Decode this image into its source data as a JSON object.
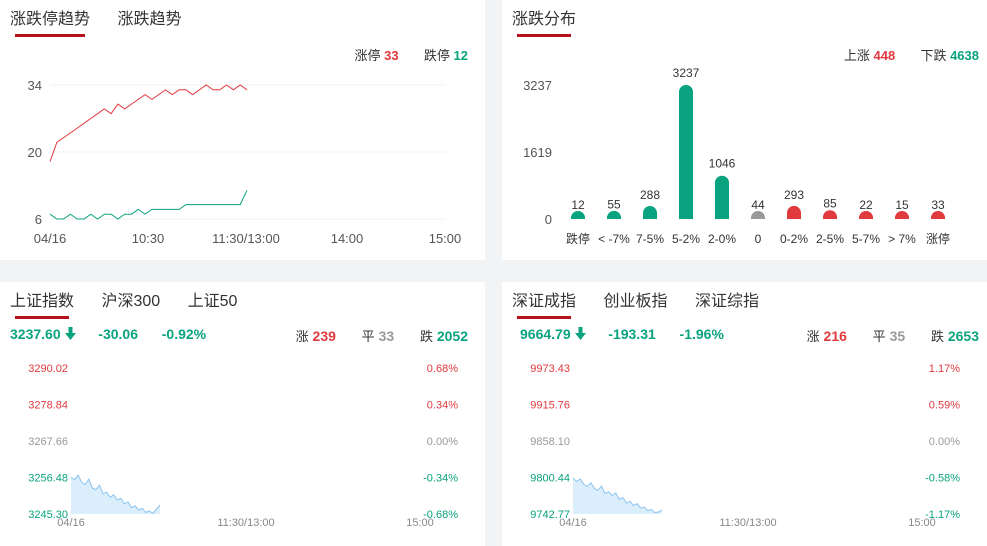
{
  "limit_trend": {
    "tabs": [
      "涨跌停趋势",
      "涨跌趋势"
    ],
    "summary": {
      "up_label": "涨停",
      "up_value": "33",
      "down_label": "跌停",
      "down_value": "12"
    },
    "chart_data": {
      "type": "line",
      "x_ticks": [
        "04/16",
        "10:30",
        "11:30/13:00",
        "14:00",
        "15:00"
      ],
      "y_ticks": [
        "34",
        "20",
        "6"
      ],
      "ylim": [
        6,
        34
      ],
      "series": [
        {
          "name": "涨停",
          "color": "#e0393e",
          "values": [
            18,
            22,
            23,
            24,
            25,
            26,
            27,
            28,
            29,
            28,
            30,
            29,
            30,
            31,
            32,
            31,
            32,
            33,
            32,
            33,
            33,
            32,
            33,
            34,
            33,
            33,
            34,
            33,
            34,
            33
          ]
        },
        {
          "name": "跌停",
          "color": "#0aa37f",
          "values": [
            7,
            6,
            6,
            7,
            6,
            6,
            7,
            6,
            7,
            7,
            6,
            7,
            7,
            8,
            7,
            8,
            8,
            8,
            8,
            8,
            9,
            9,
            9,
            9,
            9,
            9,
            9,
            9,
            9,
            12
          ]
        }
      ]
    }
  },
  "distribution": {
    "tabs": [
      "涨跌分布"
    ],
    "summary": {
      "up_label": "上涨",
      "up_value": "448",
      "down_label": "下跌",
      "down_value": "4638"
    },
    "chart_data": {
      "type": "bar",
      "categories": [
        "跌停",
        "< -7%",
        "7-5%",
        "5-2%",
        "2-0%",
        "0",
        "0-2%",
        "2-5%",
        "5-7%",
        "> 7%",
        "涨停"
      ],
      "values": [
        12,
        55,
        288,
        3237,
        1046,
        44,
        293,
        85,
        22,
        15,
        33
      ],
      "colors": [
        "#0aa37f",
        "#0aa37f",
        "#0aa37f",
        "#0aa37f",
        "#0aa37f",
        "#999999",
        "#e0393e",
        "#e0393e",
        "#e0393e",
        "#e0393e",
        "#e0393e"
      ],
      "y_ticks": [
        "3237",
        "1619",
        "0"
      ],
      "ylim": [
        0,
        3237
      ]
    }
  },
  "sh_index": {
    "tabs": [
      "上证指数",
      "沪深300",
      "上证50"
    ],
    "price": "3237.60",
    "change": "-30.06",
    "change_pct": "-0.92%",
    "up_label": "涨",
    "up_count": "239",
    "flat_label": "平",
    "flat_count": "33",
    "down_label": "跌",
    "down_count": "2052",
    "chart_data": {
      "type": "area",
      "y_left": [
        "3290.02",
        "3278.84",
        "3267.66",
        "3256.48",
        "3245.30"
      ],
      "y_right": [
        "0.68%",
        "0.34%",
        "0.00%",
        "-0.34%",
        "-0.68%"
      ],
      "x_ticks": [
        "04/16",
        "11:30/13:00",
        "15:00"
      ],
      "ylim": [
        3245.3,
        3290.02
      ],
      "values": [
        3256.5,
        3255.8,
        3257.2,
        3255.0,
        3254.3,
        3256.0,
        3253.2,
        3252.8,
        3254.1,
        3251.5,
        3252.0,
        3250.4,
        3251.2,
        3249.6,
        3250.1,
        3248.4,
        3249.0,
        3247.2,
        3247.8,
        3246.5,
        3247.0,
        3245.8,
        3246.2,
        3245.5,
        3246.8,
        3248.1
      ]
    }
  },
  "sz_index": {
    "tabs": [
      "深证成指",
      "创业板指",
      "深证综指"
    ],
    "price": "9664.79",
    "change": "-193.31",
    "change_pct": "-1.96%",
    "up_label": "涨",
    "up_count": "216",
    "flat_label": "平",
    "flat_count": "35",
    "down_label": "跌",
    "down_count": "2653",
    "chart_data": {
      "type": "area",
      "y_left": [
        "9973.43",
        "9915.76",
        "9858.10",
        "9800.44",
        "9742.77"
      ],
      "y_right": [
        "1.17%",
        "0.59%",
        "0.00%",
        "-0.58%",
        "-1.17%"
      ],
      "x_ticks": [
        "04/16",
        "11:30/13:00",
        "15:00"
      ],
      "ylim": [
        9742.77,
        9973.43
      ],
      "values": [
        9800.0,
        9794.0,
        9798.0,
        9790.0,
        9786.0,
        9792.0,
        9783.0,
        9780.0,
        9787.0,
        9775.0,
        9778.0,
        9772.0,
        9776.0,
        9766.0,
        9769.0,
        9760.0,
        9763.0,
        9756.0,
        9759.0,
        9752.0,
        9754.0,
        9748.0,
        9750.0,
        9745.0,
        9746.0,
        9749.0
      ]
    }
  }
}
